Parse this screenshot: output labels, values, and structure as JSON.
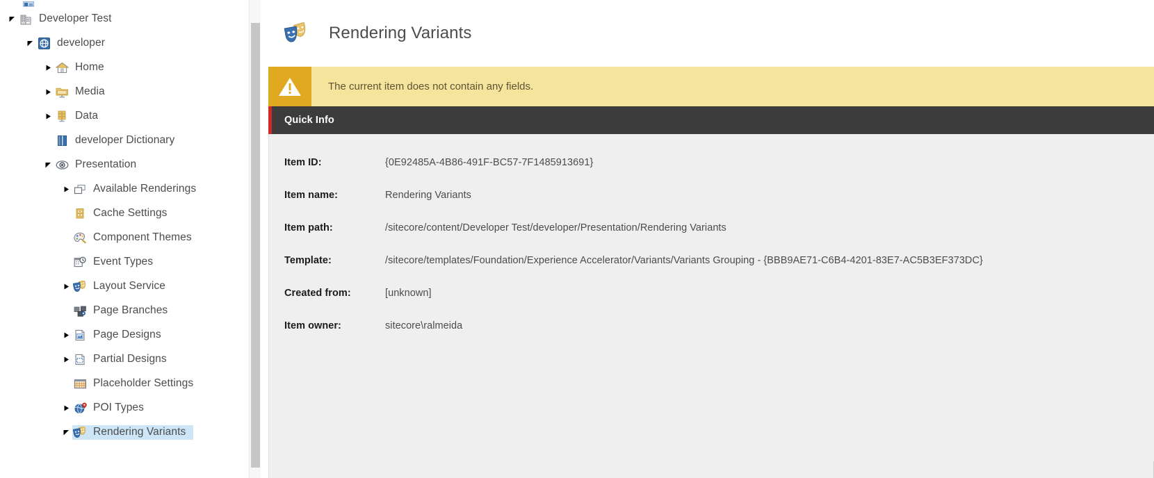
{
  "colors": {
    "accent_red": "#cf2a2a",
    "warning_bg": "#f5e49b",
    "warning_icon_bg": "#dfa921",
    "section_header_bg": "#3c3c3c",
    "panel_bg": "#efefef",
    "selection_bg": "#cde6f7",
    "icon_blue": "#3a6fb0",
    "icon_yellow": "#e8c46a",
    "text_gray": "#4c4c4c"
  },
  "content_tree": {
    "items": [
      {
        "label": "Developer Test",
        "depth": 0,
        "twisty": "expanded",
        "icon": "building-icon",
        "selected": false
      },
      {
        "label": "developer",
        "depth": 1,
        "twisty": "expanded",
        "icon": "globe-site-icon",
        "selected": false
      },
      {
        "label": "Home",
        "depth": 2,
        "twisty": "collapsed",
        "icon": "home-icon",
        "selected": false
      },
      {
        "label": "Media",
        "depth": 2,
        "twisty": "collapsed",
        "icon": "media-folder-icon",
        "selected": false
      },
      {
        "label": "Data",
        "depth": 2,
        "twisty": "collapsed",
        "icon": "data-drawers-icon",
        "selected": false
      },
      {
        "label": "developer Dictionary",
        "depth": 2,
        "twisty": "none",
        "icon": "dictionary-book-icon",
        "selected": false
      },
      {
        "label": "Presentation",
        "depth": 2,
        "twisty": "expanded",
        "icon": "eye-icon",
        "selected": false
      },
      {
        "label": "Available Renderings",
        "depth": 3,
        "twisty": "collapsed",
        "icon": "renderings-icon",
        "selected": false
      },
      {
        "label": "Cache Settings",
        "depth": 3,
        "twisty": "none",
        "icon": "cache-settings-icon",
        "selected": false
      },
      {
        "label": "Component Themes",
        "depth": 3,
        "twisty": "none",
        "icon": "palette-icon",
        "selected": false
      },
      {
        "label": "Event Types",
        "depth": 3,
        "twisty": "none",
        "icon": "calendar-clock-icon",
        "selected": false
      },
      {
        "label": "Layout Service",
        "depth": 3,
        "twisty": "collapsed",
        "icon": "theater-masks-icon",
        "selected": false
      },
      {
        "label": "Page Branches",
        "depth": 3,
        "twisty": "none",
        "icon": "page-branches-icon",
        "selected": false
      },
      {
        "label": "Page Designs",
        "depth": 3,
        "twisty": "collapsed",
        "icon": "page-design-icon",
        "selected": false
      },
      {
        "label": "Partial Designs",
        "depth": 3,
        "twisty": "collapsed",
        "icon": "partial-design-icon",
        "selected": false
      },
      {
        "label": "Placeholder Settings",
        "depth": 3,
        "twisty": "none",
        "icon": "placeholder-settings-icon",
        "selected": false
      },
      {
        "label": "POI Types",
        "depth": 3,
        "twisty": "collapsed",
        "icon": "poi-globe-pin-icon",
        "selected": false
      },
      {
        "label": "Rendering Variants",
        "depth": 3,
        "twisty": "expanded",
        "icon": "theater-masks-icon",
        "selected": true
      }
    ]
  },
  "editor": {
    "title": "Rendering Variants",
    "title_icon": "theater-masks-icon",
    "warning": {
      "icon": "warning-triangle-icon",
      "message": "The current item does not contain any fields."
    },
    "section": {
      "title": "Quick Info"
    },
    "quick_info": {
      "rows": [
        {
          "label": "Item ID:",
          "value": "{0E92485A-4B86-491F-BC57-7F1485913691}"
        },
        {
          "label": "Item name:",
          "value": "Rendering Variants"
        },
        {
          "label": "Item path:",
          "value": "/sitecore/content/Developer Test/developer/Presentation/Rendering Variants"
        },
        {
          "label": "Template:",
          "value": "/sitecore/templates/Foundation/Experience Accelerator/Variants/Variants Grouping - {BBB9AE71-C6B4-4201-83E7-AC5B3EF373DC}"
        },
        {
          "label": "Created from:",
          "value": "[unknown]"
        },
        {
          "label": "Item owner:",
          "value": "sitecore\\ralmeida"
        }
      ]
    }
  }
}
